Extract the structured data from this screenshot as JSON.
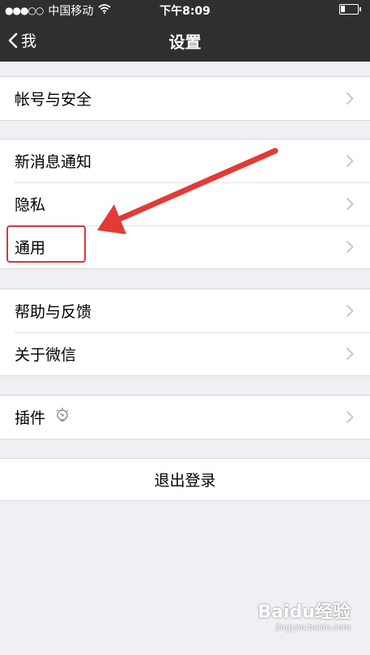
{
  "status_bar": {
    "signal": "●●●○○",
    "carrier": "中国移动",
    "wifi_icon": "wifi-icon",
    "time": "下午8:09",
    "battery_icon": "battery-icon"
  },
  "nav": {
    "back_label": "我",
    "title": "设置"
  },
  "groups": [
    {
      "items": [
        {
          "label": "帐号与安全"
        }
      ]
    },
    {
      "items": [
        {
          "label": "新消息通知"
        },
        {
          "label": "隐私"
        },
        {
          "label": "通用"
        }
      ]
    },
    {
      "items": [
        {
          "label": "帮助与反馈"
        },
        {
          "label": "关于微信"
        }
      ]
    },
    {
      "items": [
        {
          "label": "插件",
          "icon": "lightbulb-icon"
        }
      ]
    }
  ],
  "logout_label": "退出登录",
  "annotation": {
    "highlight_color": "#d9363e",
    "arrow_color": "#e23b36"
  },
  "watermark": {
    "text": "Baidu经验",
    "sub": "jingyan.baidu.com"
  }
}
